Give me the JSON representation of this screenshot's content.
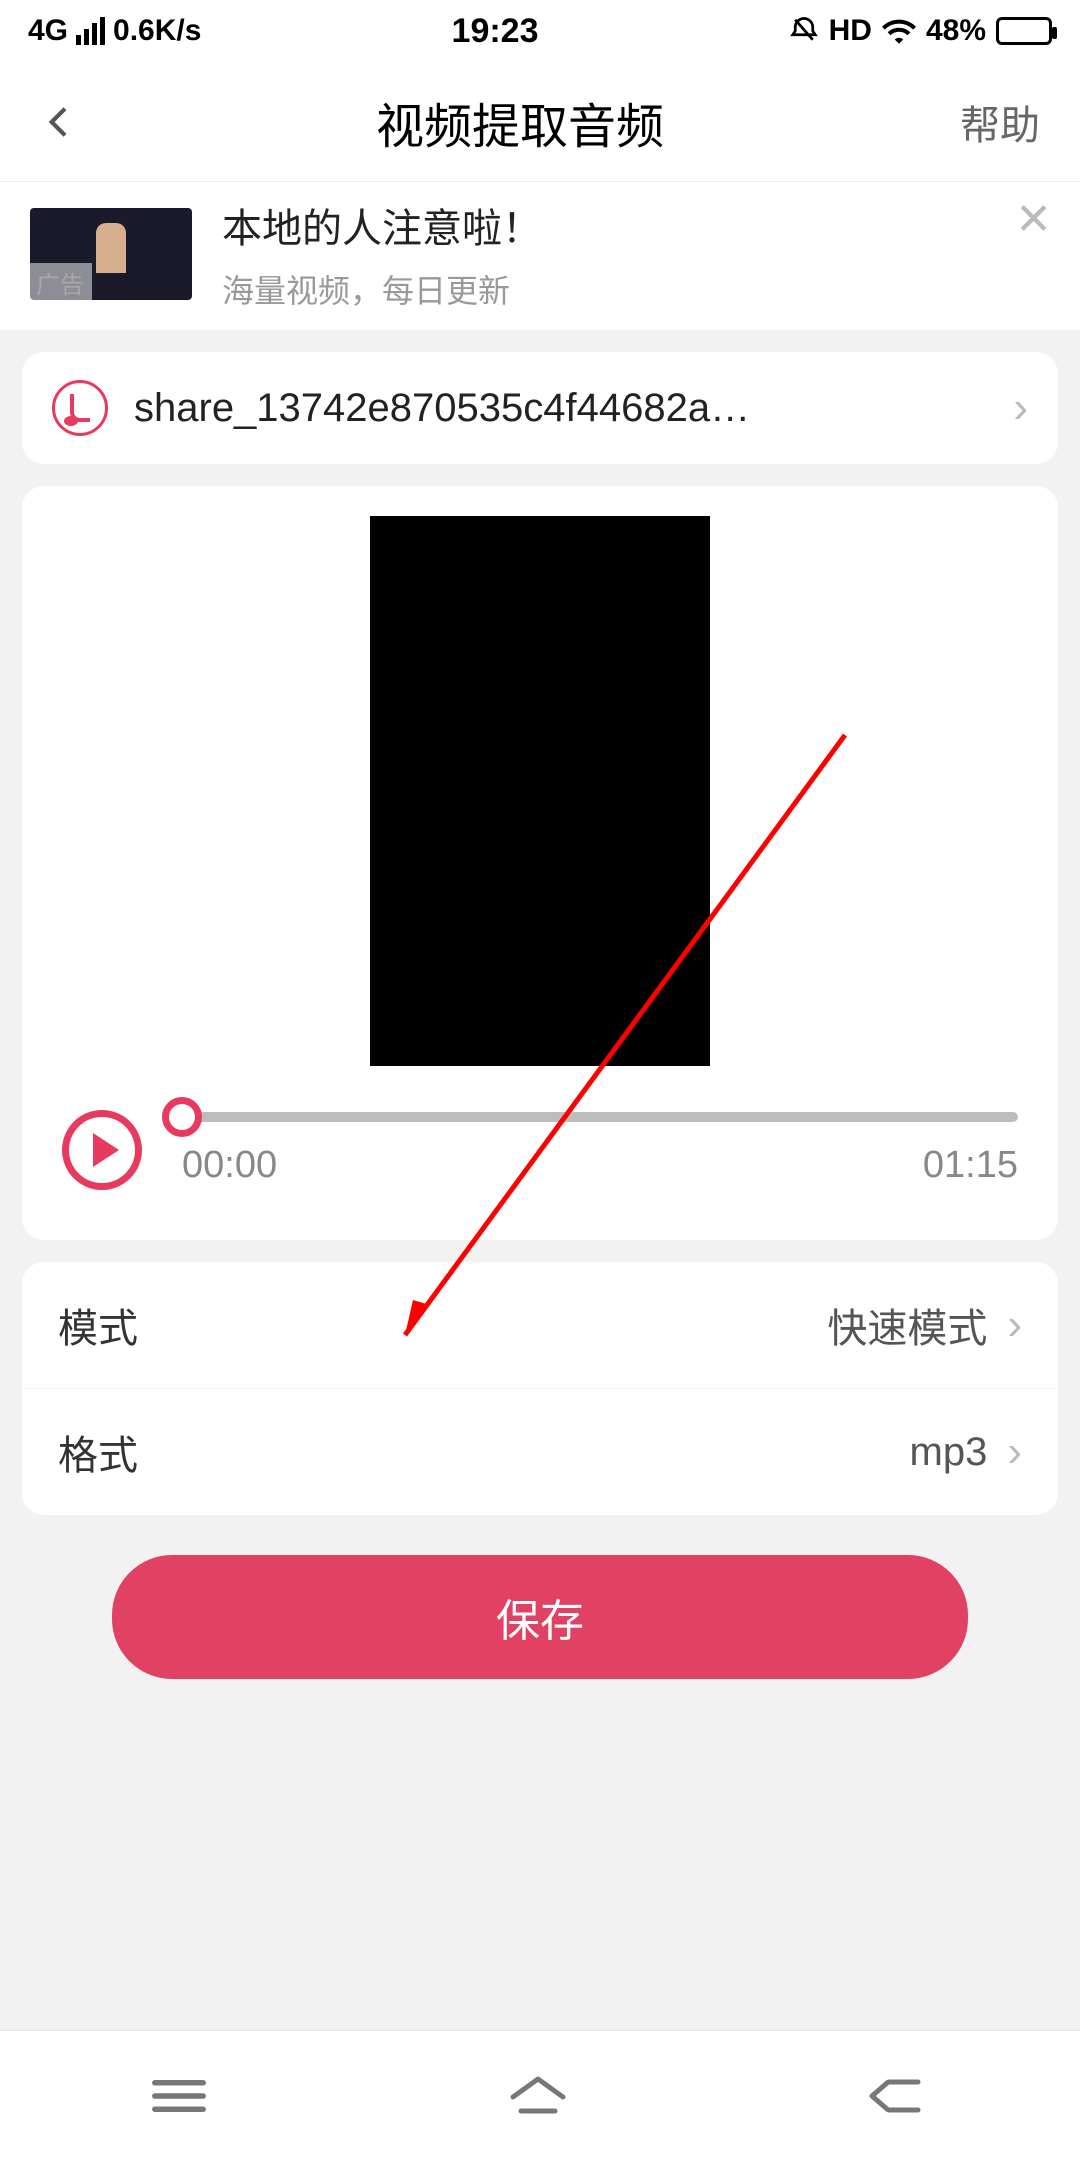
{
  "status": {
    "network": "4G",
    "speed": "0.6K/s",
    "time": "19:23",
    "hd": "HD",
    "battery_pct": "48%"
  },
  "header": {
    "title": "视频提取音频",
    "help": "帮助"
  },
  "ad": {
    "tag": "广告",
    "title": "本地的人注意啦！",
    "subtitle": "海量视频，每日更新"
  },
  "file": {
    "name": "share_13742e870535c4f44682a…"
  },
  "player": {
    "current": "00:00",
    "duration": "01:15"
  },
  "settings": {
    "mode_label": "模式",
    "mode_value": "快速模式",
    "format_label": "格式",
    "format_value": "mp3"
  },
  "actions": {
    "save": "保存"
  },
  "colors": {
    "accent": "#e83a5e",
    "save_bg": "#e14264"
  }
}
